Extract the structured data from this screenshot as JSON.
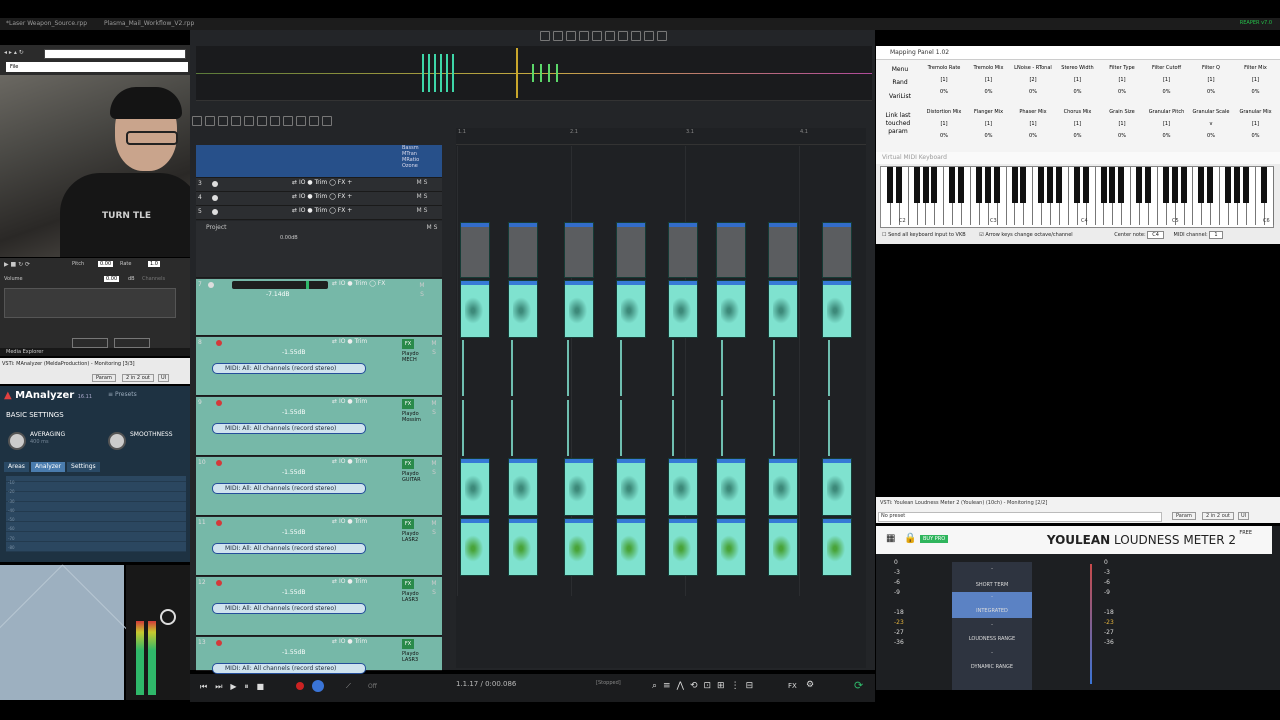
{
  "titlebar": {
    "tab1": "*Laser Weapon_Source.rpp",
    "tab2": "Plasma_Mail_Workflow_V2.rpp",
    "status": "REAPER v7.0",
    "status_color": "#25c04a"
  },
  "webcam": {
    "file_label": "File",
    "shirt_text": "TURN TLE",
    "pitch_label": "Pitch",
    "pitch_value": "0.00",
    "rate_label": "Rate",
    "rate_value": "1.0",
    "volume_label": "Volume",
    "volume_value": "0.00",
    "volume_unit": "dB",
    "channels": "Channels"
  },
  "media_explorer_label": "Media Explorer",
  "manalyzer": {
    "window_title": "VSTi: MAnalyzer (MeldaProduction) - Monitoring [3/3]",
    "param_btn": "Param",
    "io_btn": "2 in 2 out",
    "ui_btn": "UI",
    "title": "MAnalyzer",
    "version": "16.11",
    "presets": "Presets",
    "basic_settings": "BASIC SETTINGS",
    "averaging_label": "AVERAGING",
    "averaging_value": "400 ms",
    "smoothness_label": "SMOOTHNESS",
    "tabs": [
      "Areas",
      "Analyzer",
      "Settings"
    ],
    "active_tab": "Analyzer",
    "y_ticks": [
      "-10",
      "-20",
      "-30",
      "-40",
      "-50",
      "-60",
      "-70",
      "-80"
    ]
  },
  "tcp": {
    "project_label": "Project",
    "project_volume": "0.00dB",
    "top_track_plugins": [
      "Bassm",
      "MTran",
      "MRatio",
      "Ozone"
    ],
    "small_tracks": [
      "3",
      "4",
      "5"
    ],
    "trim_label": "Trim",
    "fx_label": "FX",
    "io_label": "IO",
    "tracks": [
      {
        "num": "7",
        "vol": "-7.14dB",
        "midi": "",
        "plugin": ""
      },
      {
        "num": "8",
        "vol": "-1.55dB",
        "midi": "MIDI: All: All channels (record stereo)",
        "plugin": "Playdo MECH"
      },
      {
        "num": "9",
        "vol": "-1.55dB",
        "midi": "MIDI: All: All channels (record stereo)",
        "plugin": "Playdo Mossim"
      },
      {
        "num": "10",
        "vol": "-1.55dB",
        "midi": "MIDI: All: All channels (record stereo)",
        "plugin": "Playdo GUITAR"
      },
      {
        "num": "11",
        "vol": "-1.55dB",
        "midi": "MIDI: All: All channels (record stereo)",
        "plugin": "Playdo LASR2"
      },
      {
        "num": "12",
        "vol": "-1.55dB",
        "midi": "MIDI: All: All channels (record stereo)",
        "plugin": "Playdo LASR3"
      },
      {
        "num": "13",
        "vol": "-1.55dB",
        "midi": "MIDI: All: All channels (record stereo)",
        "plugin": "Playdo LASR3"
      }
    ]
  },
  "ruler": [
    "1.1",
    "2.1",
    "3.1",
    "4.1"
  ],
  "transport": {
    "time": "1.1.17 / 0:00.086",
    "state": "[Stopped]",
    "off_label": "Off"
  },
  "mapping": {
    "title": "Mapping Panel 1.02",
    "side": [
      "Menu",
      "Rand",
      "VariList",
      "Link last touched param"
    ],
    "row1": [
      {
        "name": "Tremolo Rate",
        "val": "[1]",
        "pct": "0%"
      },
      {
        "name": "Tremolo Mix",
        "val": "[1]",
        "pct": "0%"
      },
      {
        "name": "LNoise - RTonal",
        "val": "[2]",
        "pct": "0%"
      },
      {
        "name": "Stereo Width",
        "val": "[1]",
        "pct": "0%"
      },
      {
        "name": "Filter Type",
        "val": "[1]",
        "pct": "0%"
      },
      {
        "name": "Filter Cutoff",
        "val": "[1]",
        "pct": "0%"
      },
      {
        "name": "Filter Q",
        "val": "[1]",
        "pct": "0%"
      },
      {
        "name": "Filter Mix",
        "val": "[1]",
        "pct": "0%"
      }
    ],
    "row2": [
      {
        "name": "Distortion Mix",
        "val": "[1]",
        "pct": "0%"
      },
      {
        "name": "Flanger Mix",
        "val": "[1]",
        "pct": "0%"
      },
      {
        "name": "Phaser Mix",
        "val": "[1]",
        "pct": "0%"
      },
      {
        "name": "Chorus Mix",
        "val": "[1]",
        "pct": "0%"
      },
      {
        "name": "Grain Size",
        "val": "[1]",
        "pct": "0%"
      },
      {
        "name": "Granular Pitch",
        "val": "[1]",
        "pct": "0%"
      },
      {
        "name": "Granular Scale",
        "val": "v",
        "pct": "0%"
      },
      {
        "name": "Granular Mix",
        "val": "[1]",
        "pct": "0%"
      }
    ]
  },
  "vkb": {
    "title": "Virtual MIDI Keyboard",
    "labels": [
      "C2",
      "C3",
      "C4",
      "C5",
      "C6"
    ],
    "opt1": "Send all keyboard input to VKB",
    "opt2": "Arrow keys change octave/channel",
    "center_note_label": "Center note:",
    "center_note": "C4",
    "midi_channel_label": "MIDI channel:",
    "midi_channel": "1"
  },
  "youlean": {
    "window_title": "VSTi: Youlean Loudness Meter 2 (Youlean) (10ch) - Monitoring [2/2]",
    "preset": "No preset",
    "param_btn": "Param",
    "io_btn": "2 in 2 out",
    "ui_btn": "UI",
    "buy_pro": "BUY PRO",
    "brand_bold": "YOULEAN",
    "brand_rest": " LOUDNESS METER 2",
    "free": "FREE",
    "scale": [
      "0",
      "-3",
      "-6",
      "-9",
      "-18",
      "-23",
      "-27",
      "-36"
    ],
    "short_term": "SHORT TERM",
    "integrated": "INTEGRATED",
    "loudness_range": "LOUDNESS RANGE",
    "dynamic_range": "DYNAMIC RANGE",
    "dash": "-"
  }
}
